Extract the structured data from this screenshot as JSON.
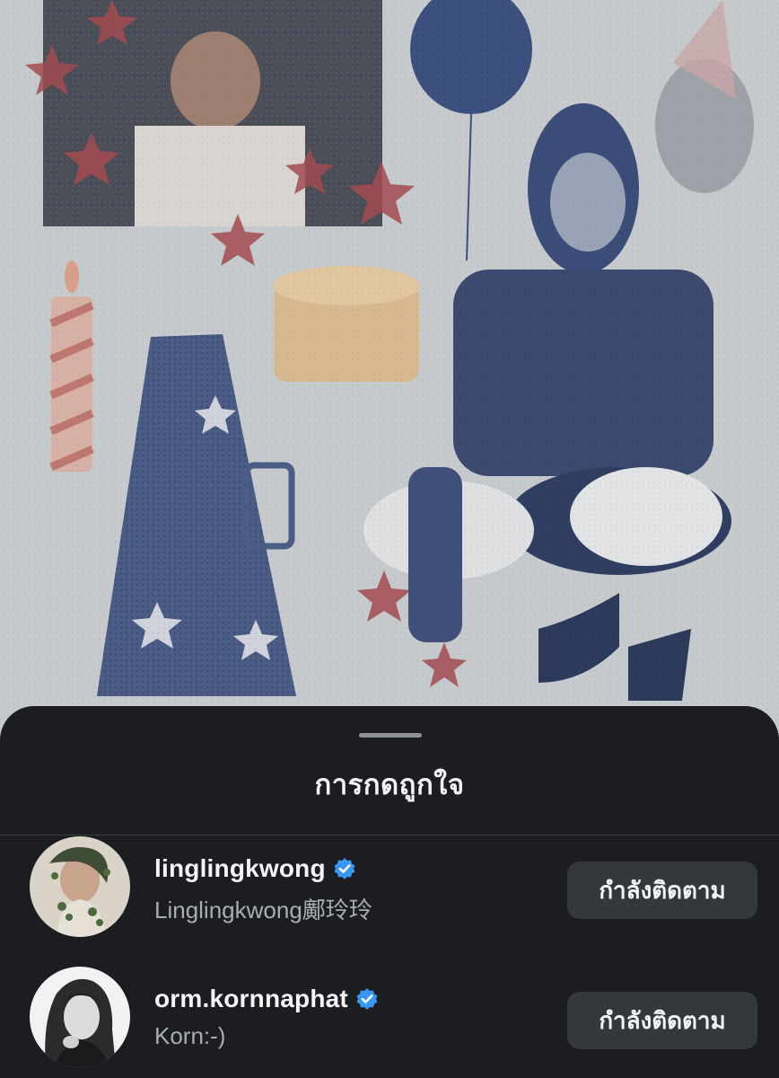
{
  "post": {
    "image_icon": "birthday-collage-photo"
  },
  "sheet": {
    "title": "การกดถูกใจ",
    "grabber_icon": "drag-handle-icon"
  },
  "likers": [
    {
      "username": "linglingkwong",
      "full_name": "Linglingkwong鄺玲玲",
      "verified": true,
      "follow_label": "กำลังติดตาม"
    },
    {
      "username": "orm.kornnaphat",
      "full_name": "Korn:-)",
      "verified": true,
      "follow_label": "กำลังติดตาม"
    }
  ],
  "colors": {
    "sheet_bg": "#1b1d21",
    "button_bg": "#34373c",
    "verified_blue": "#3897f0",
    "secondary_text": "#a9adb3"
  }
}
